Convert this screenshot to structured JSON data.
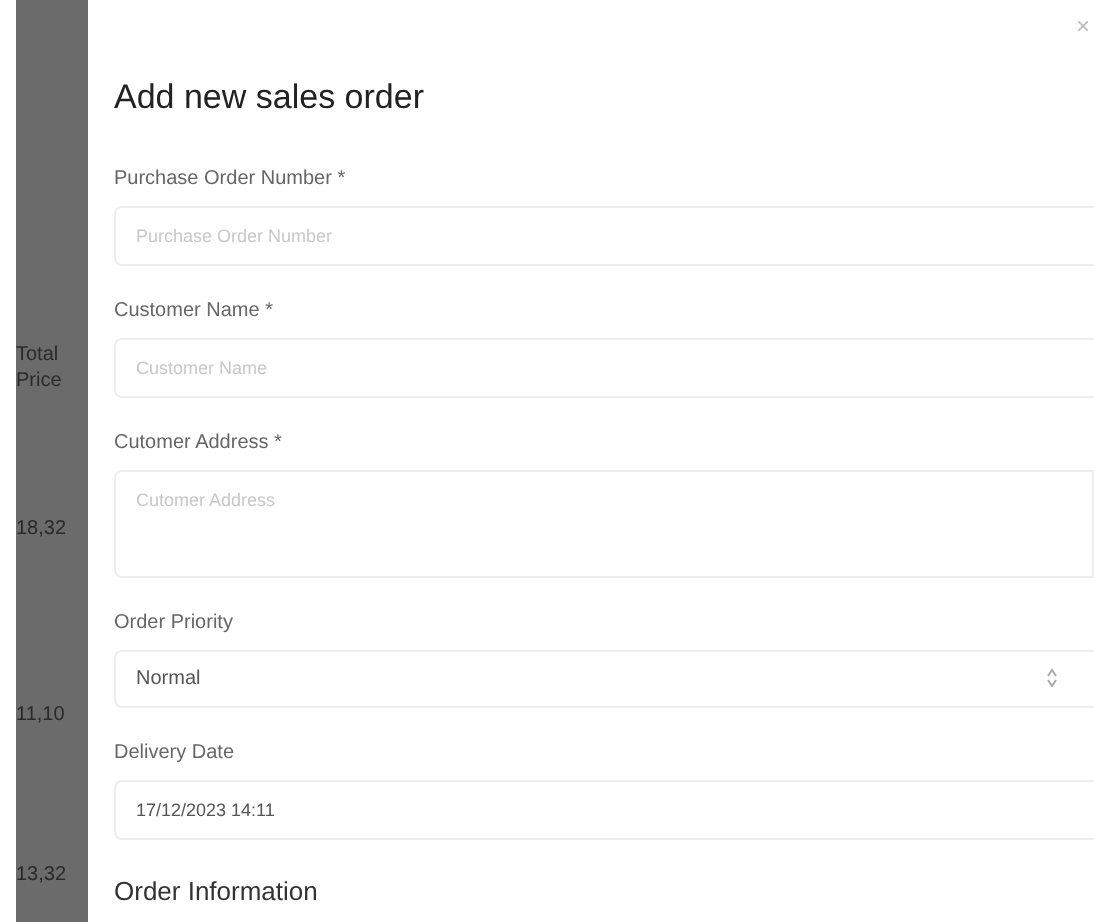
{
  "background_table": {
    "column_heading": [
      "Total",
      "Price"
    ],
    "cells": [
      "18,32",
      "11,10",
      "13,32"
    ]
  },
  "dialog": {
    "close": "×",
    "title": "Add new sales order",
    "fields": [
      {
        "kind": "input",
        "label": "Purchase Order Number *",
        "placeholder": "Purchase Order Number"
      },
      {
        "kind": "input",
        "label": "Customer Name *",
        "placeholder": "Customer Name"
      },
      {
        "kind": "textarea",
        "label": "Cutomer Address *",
        "placeholder": "Cutomer Address"
      },
      {
        "kind": "select",
        "label": "Order Priority",
        "value": "Normal"
      },
      {
        "kind": "input",
        "label": "Delivery Date",
        "value": "17/12/2023 14:11"
      }
    ],
    "section_heading": "Order Information"
  }
}
